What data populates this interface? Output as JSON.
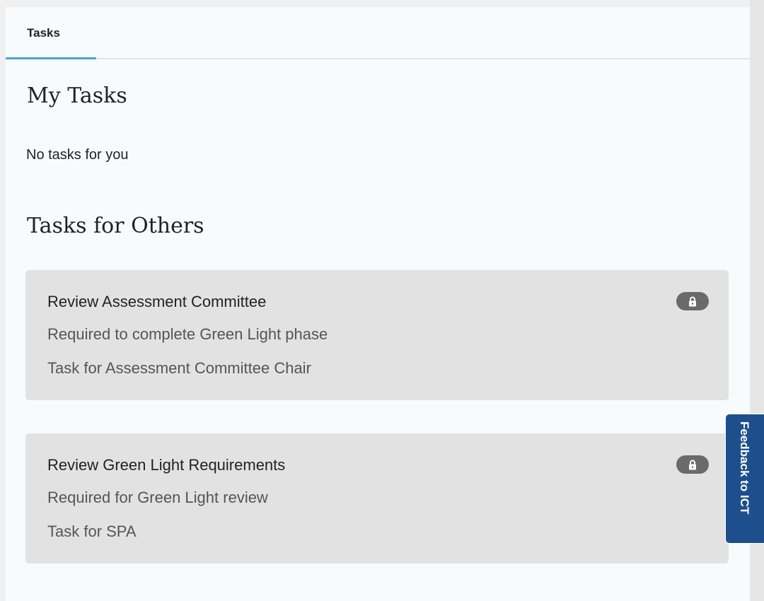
{
  "tabs": [
    {
      "label": "Tasks",
      "active": true
    }
  ],
  "my_tasks": {
    "heading": "My Tasks",
    "empty_message": "No tasks for you"
  },
  "tasks_for_others": {
    "heading": "Tasks for Others",
    "items": [
      {
        "title": "Review Assessment Committee",
        "requirement": "Required to complete Green Light phase",
        "assignee": "Task for Assessment Committee Chair",
        "icon": "lock-icon"
      },
      {
        "title": "Review Green Light Requirements",
        "requirement": "Required for Green Light review",
        "assignee": "Task for SPA",
        "icon": "lock-icon"
      }
    ]
  },
  "feedback": {
    "label": "Feedback to ICT"
  },
  "colors": {
    "panel_bg": "#f7fbfe",
    "card_bg": "#e2e2e2",
    "accent": "#4aa8c8",
    "feedback_bg": "#1e4f8c",
    "badge_bg": "#6a6a6a"
  }
}
